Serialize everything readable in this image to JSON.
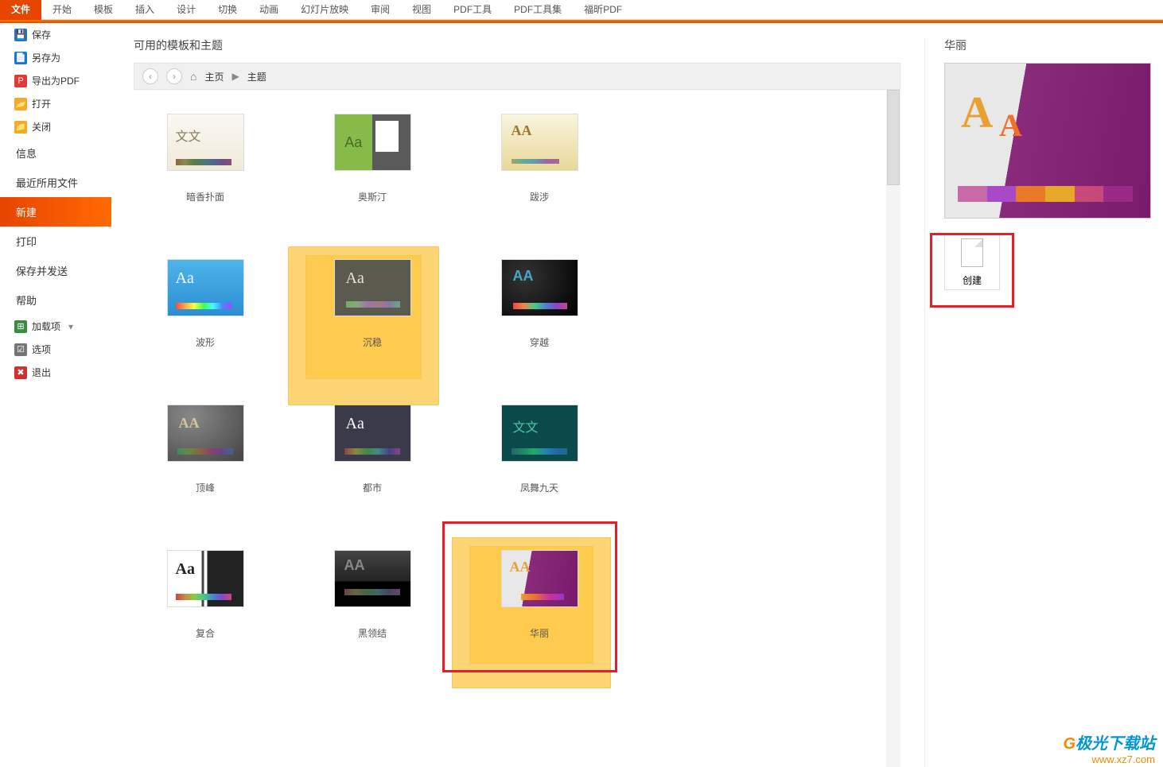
{
  "ribbon": {
    "tabs": [
      "文件",
      "开始",
      "模板",
      "插入",
      "设计",
      "切换",
      "动画",
      "幻灯片放映",
      "审阅",
      "视图",
      "PDF工具",
      "PDF工具集",
      "福昕PDF"
    ],
    "active": "文件"
  },
  "sidebar": {
    "save": "保存",
    "save_as": "另存为",
    "export_pdf": "导出为PDF",
    "open": "打开",
    "close": "关闭",
    "info": "信息",
    "recent": "最近所用文件",
    "new": "新建",
    "print": "打印",
    "save_send": "保存并发送",
    "help": "帮助",
    "addon": "加载项",
    "options": "选项",
    "exit": "退出"
  },
  "content": {
    "section_title": "可用的模板和主题",
    "breadcrumb": {
      "home": "主页",
      "current": "主题"
    },
    "templates": {
      "t1": "暗香扑面",
      "t2": "奥斯汀",
      "t3": "跋涉",
      "t4": "波形",
      "t5": "沉稳",
      "t6": "穿越",
      "t7": "顶峰",
      "t8": "都市",
      "t9": "凤舞九天",
      "t10": "复合",
      "t11": "黑领结",
      "t12": "华丽"
    }
  },
  "preview": {
    "title": "华丽",
    "create": "创建"
  },
  "watermark": {
    "site": "极光下载站",
    "url": "www.xz7.com"
  }
}
